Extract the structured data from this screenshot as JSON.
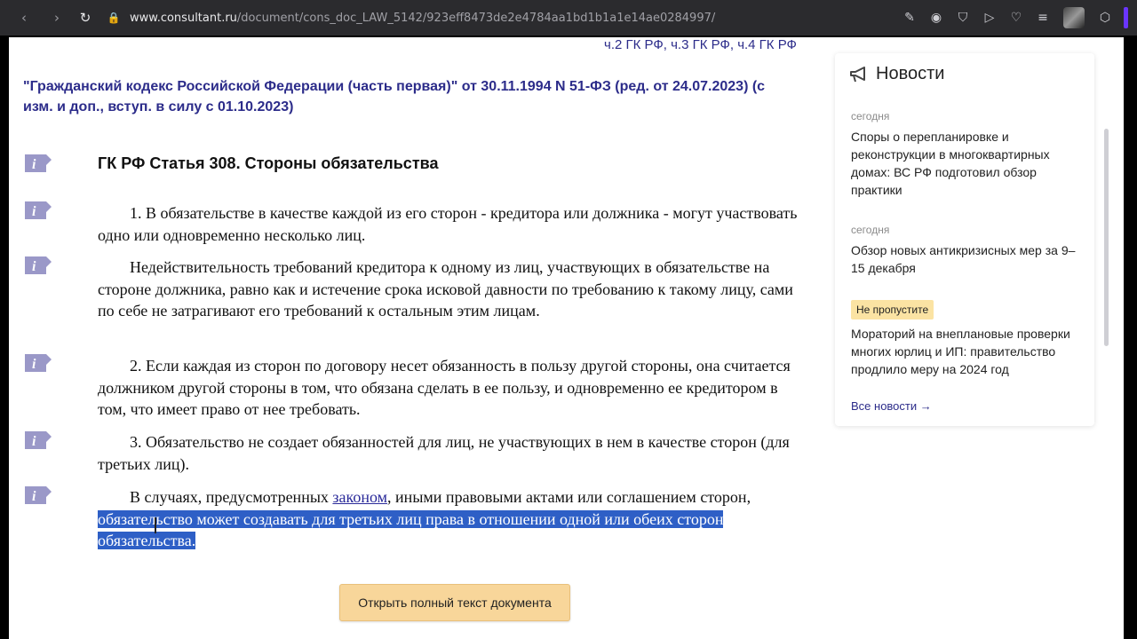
{
  "browser": {
    "url_host": "www.consultant.ru",
    "url_path": "/document/cons_doc_LAW_5142/923eff8473de2e4784aa1bd1b1a1e14ae0284997/"
  },
  "document": {
    "chunk_links": "ч.2 ГК РФ, ч.3 ГК РФ, ч.4 ГК РФ",
    "doc_link": "\"Гражданский кодекс Российской Федерации (часть первая)\" от 30.11.1994 N 51-ФЗ (ред. от 24.07.2023) (с изм. и доп., вступ. в силу с 01.10.2023)",
    "article_title": "ГК РФ Статья 308. Стороны обязательства",
    "p1": "1. В обязательстве в качестве каждой из его сторон - кредитора или должника - могут участвовать одно или одновременно несколько лиц.",
    "p2": "Недействительность требований кредитора к одному из лиц, участвующих в обязательстве на стороне должника, равно как и истечение срока исковой давности по требованию к такому лицу, сами по себе не затрагивают его требований к остальным этим лицам.",
    "p3": "2. Если каждая из сторон по договору несет обязанность в пользу другой стороны, она считается должником другой стороны в том, что обязана сделать в ее пользу, и одновременно ее кредитором в том, что имеет право от нее требовать.",
    "p4": "3. Обязательство не создает обязанностей для лиц, не участвующих в нем в качестве сторон (для третьих лиц).",
    "p5_before": "В случаях, предусмотренных ",
    "p5_link": "законом",
    "p5_mid": ", иными правовыми актами или соглашением сторон,",
    "p5_highlight": " обязательство может создавать для третьих лиц права в отношении одной или обеих сторон обязательства.",
    "open_button": "Открыть полный текст документа"
  },
  "news": {
    "title": "Новости",
    "items": [
      {
        "date": "сегодня",
        "text": "Споры о перепланировке и реконструкции в многоквартирных домах: ВС РФ подготовил обзор практики"
      },
      {
        "date": "сегодня",
        "text": "Обзор новых антикризисных мер за 9–15 декабря"
      },
      {
        "badge": "Не пропустите",
        "text": "Мораторий на внеплановые проверки многих юрлиц и ИП: правительство продлило меру на 2024 год"
      }
    ],
    "all_link": "Все новости →"
  },
  "colors": {
    "link": "#2c2c8a",
    "highlight": "#2e5fc6",
    "button": "#f8d69a",
    "badge": "#fbe3a3",
    "info_icon": "#9a98c8"
  }
}
